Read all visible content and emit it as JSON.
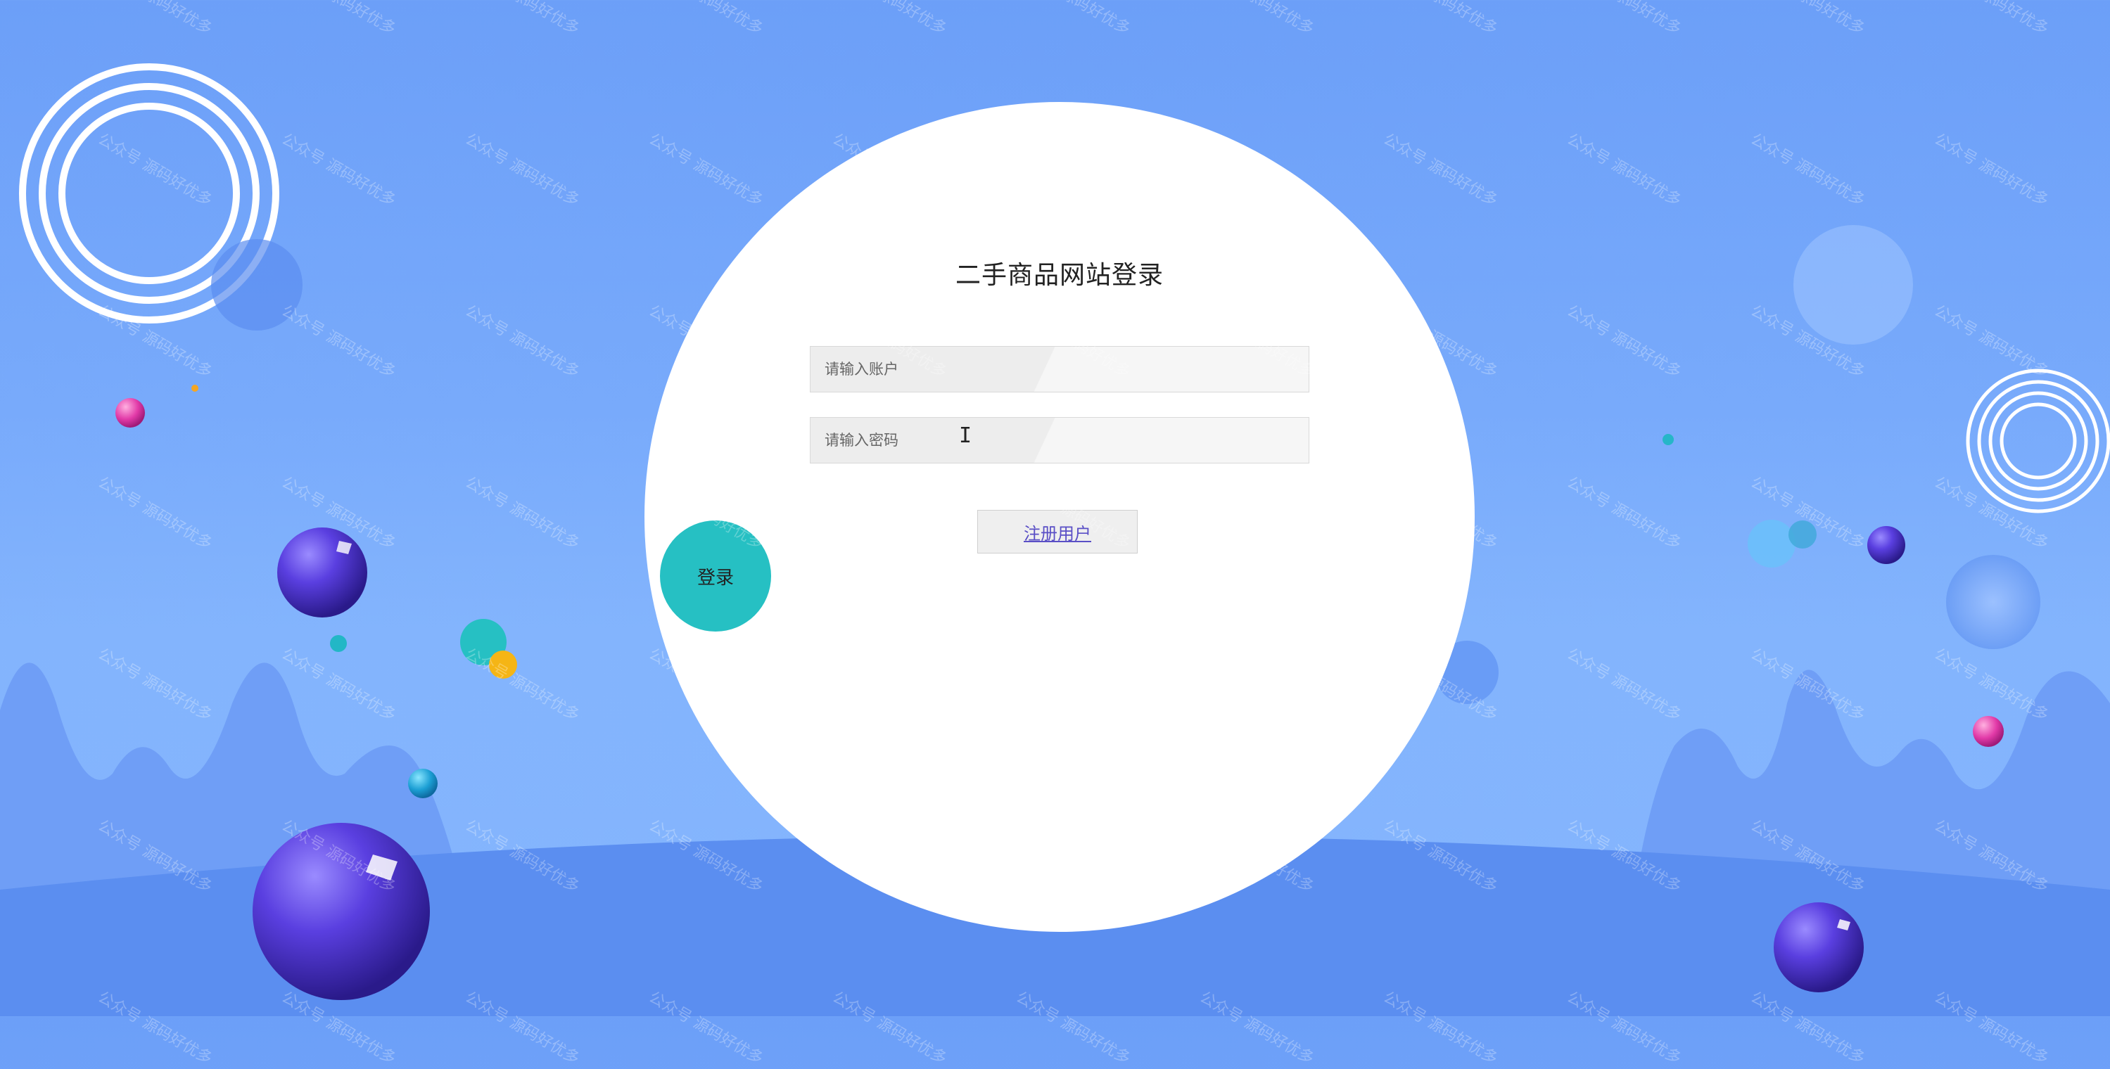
{
  "page": {
    "title": "二手商品网站登录"
  },
  "form": {
    "account_placeholder": "请输入账户",
    "password_placeholder": "请输入密码",
    "account_value": "",
    "password_value": "",
    "register_label": "注册用户",
    "login_label": "登录"
  },
  "watermark": {
    "text": "公众号 源码好优多"
  },
  "colors": {
    "background": "#78aafb",
    "login_button": "#26c0c3",
    "register_link": "#5a4fc6",
    "hill": "#5b8ef0",
    "orb_purple": "#5a3fe0"
  },
  "icons": {
    "text_cursor": "I"
  }
}
